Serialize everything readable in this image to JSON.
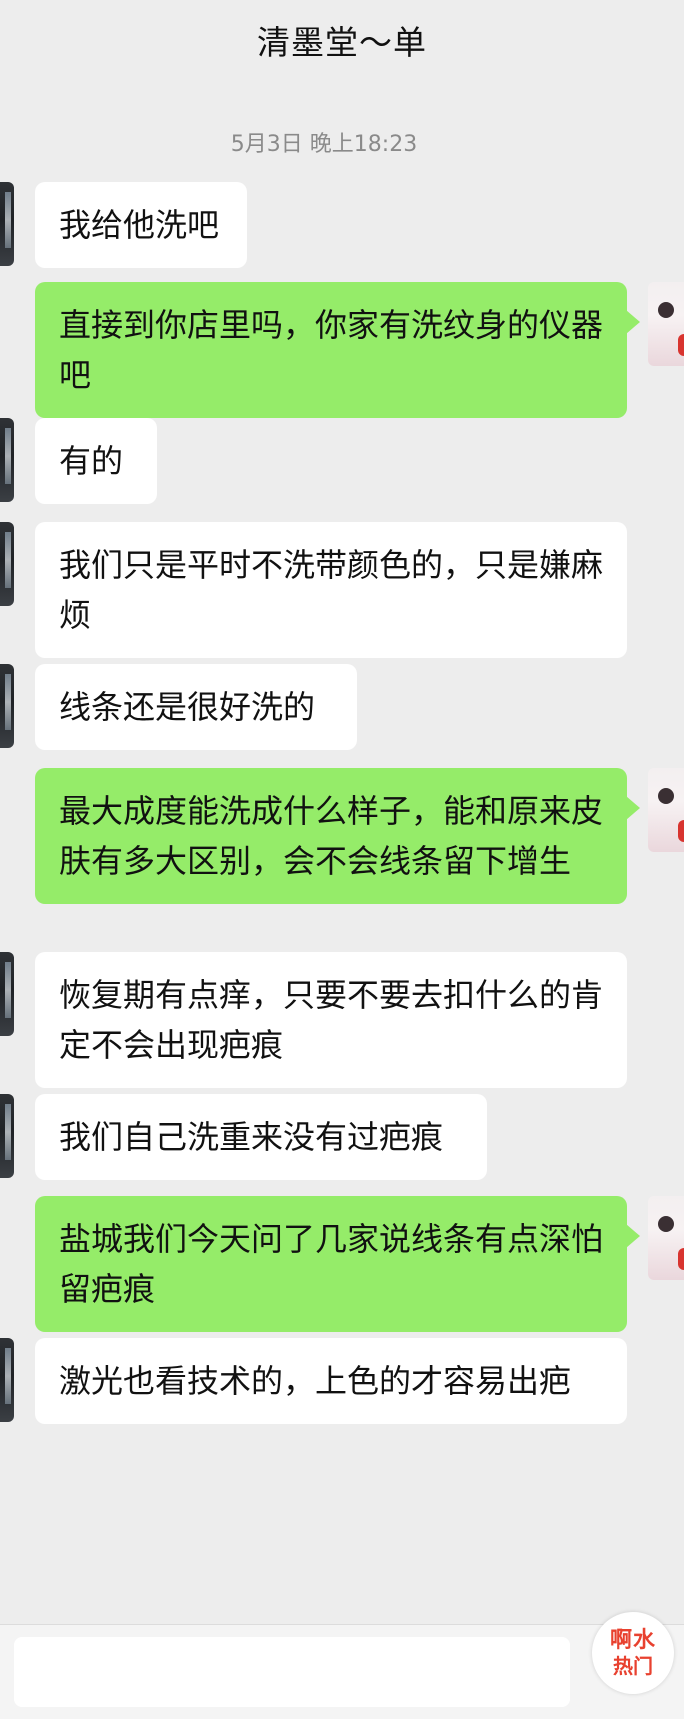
{
  "header": {
    "title": "清墨堂～单"
  },
  "timestamp": "5月3日 晚上18:23",
  "messages": [
    {
      "side": "left",
      "text": "我给他洗吧"
    },
    {
      "side": "right",
      "text": "直接到你店里吗，你家有洗纹身的仪器吧"
    },
    {
      "side": "left",
      "text": "有的"
    },
    {
      "side": "left",
      "text": "我们只是平时不洗带颜色的，只是嫌麻烦"
    },
    {
      "side": "left",
      "text": "线条还是很好洗的"
    },
    {
      "side": "right",
      "text": "最大成度能洗成什么样子，能和原来皮肤有多大区别，会不会线条留下增生"
    },
    {
      "side": "left",
      "text": "恢复期有点痒，只要不要去扣什么的肯定不会出现疤痕"
    },
    {
      "side": "left",
      "text": "我们自己洗重来没有过疤痕"
    },
    {
      "side": "right",
      "text": "盐城我们今天问了几家说线条有点深怕留疤痕"
    },
    {
      "side": "left",
      "text": "激光也看技术的，上色的才容易出疤"
    }
  ],
  "watermark": {
    "line1": "啊水",
    "line2": "热门"
  },
  "colors": {
    "background": "#ededed",
    "incoming_bubble": "#ffffff",
    "outgoing_bubble": "#95ec69",
    "watermark": "#e8412f"
  }
}
